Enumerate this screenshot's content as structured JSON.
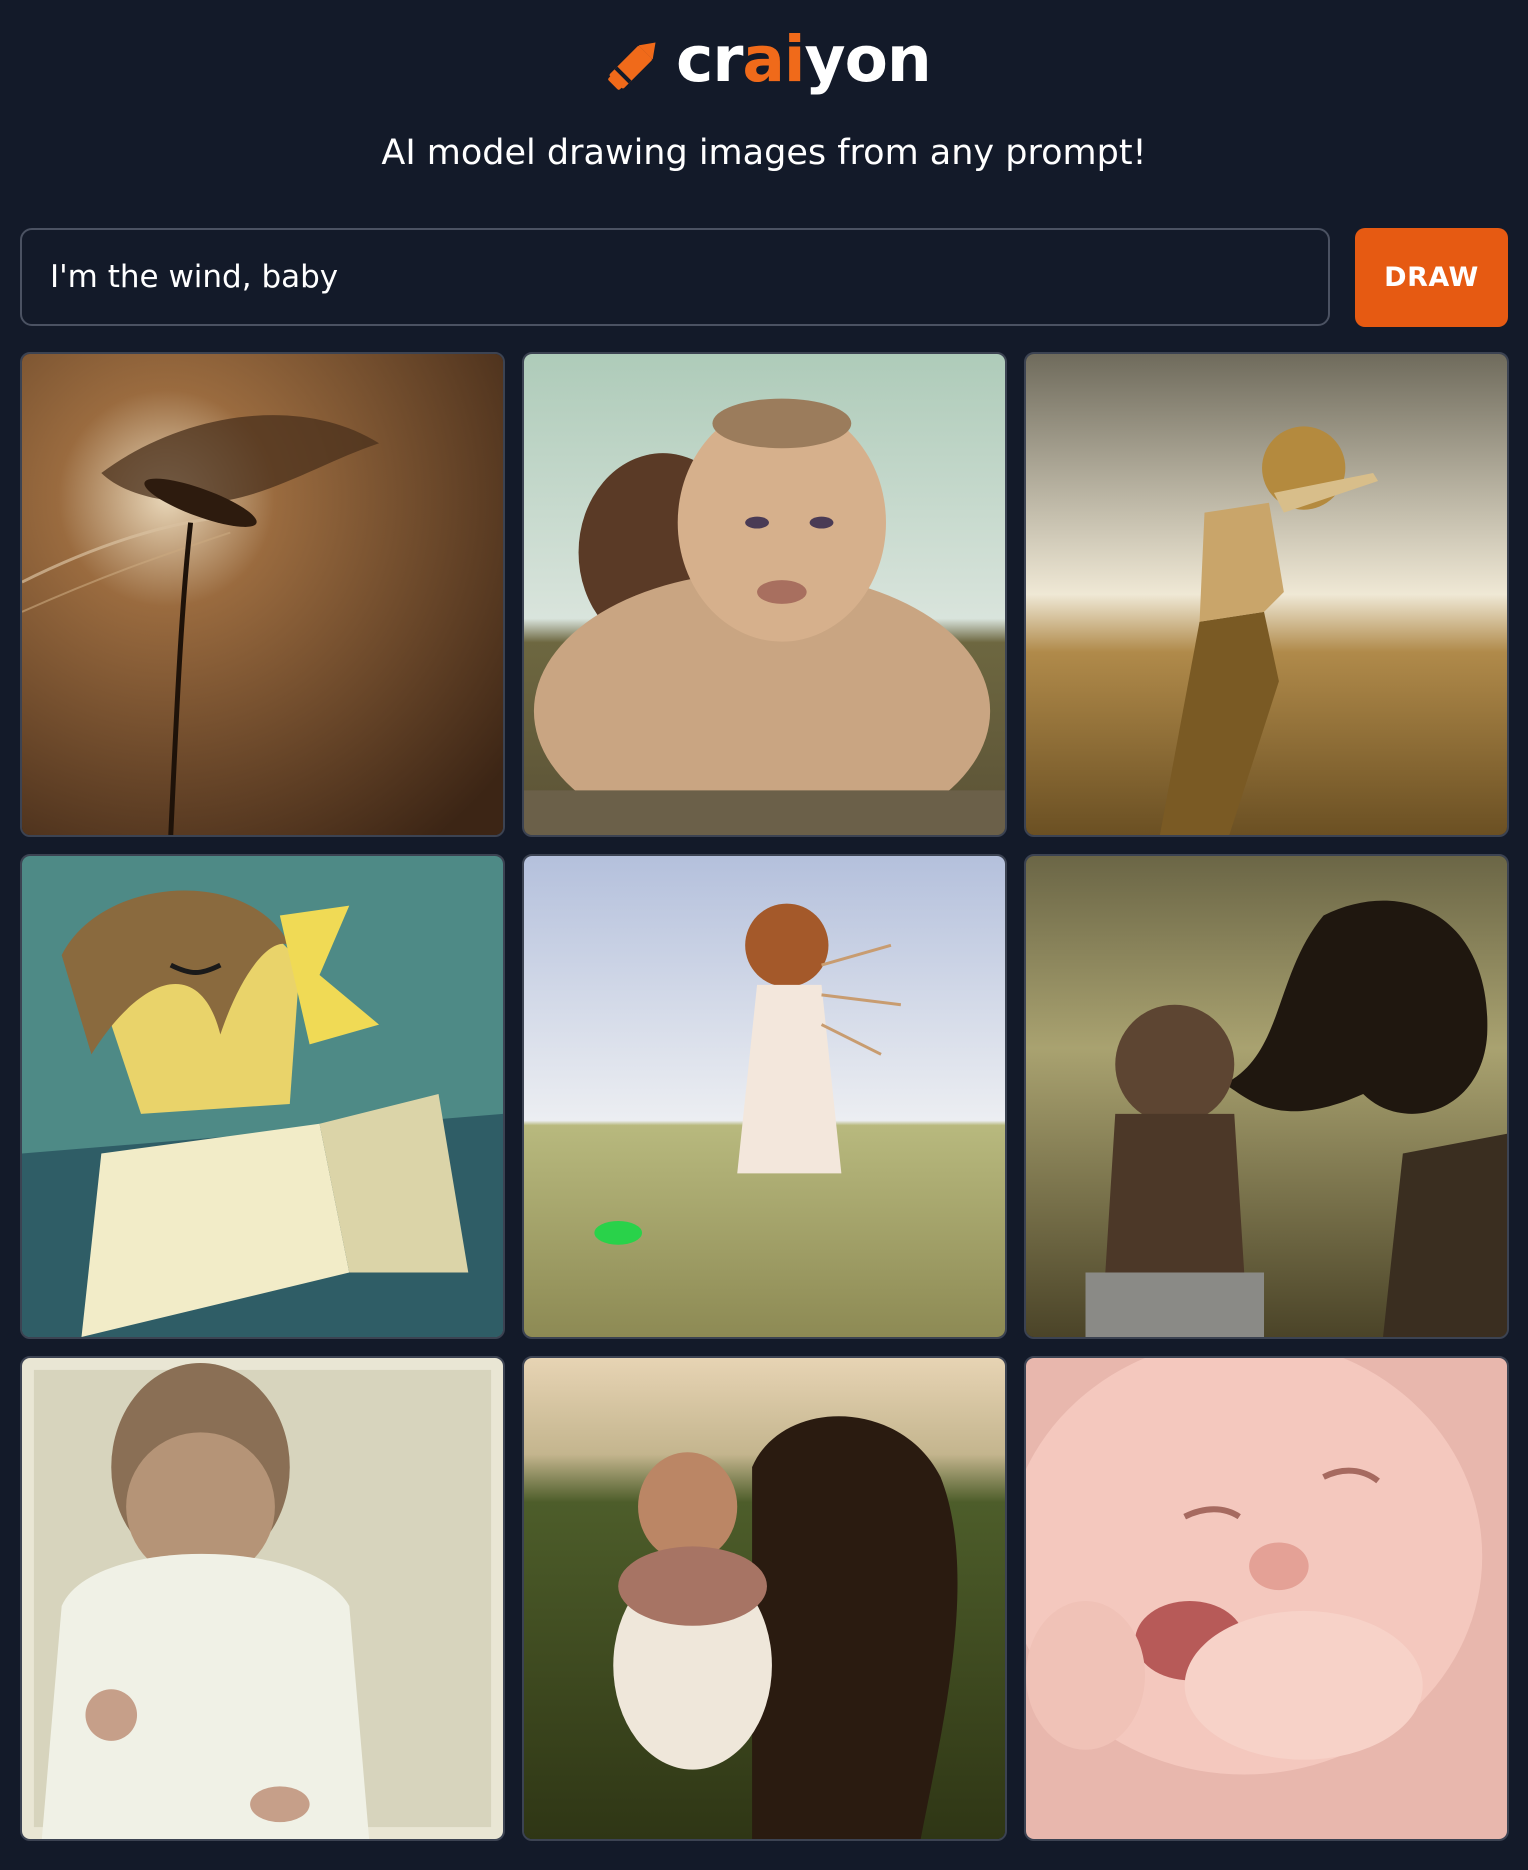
{
  "header": {
    "logo_prefix": "cr",
    "logo_accent": "ai",
    "logo_suffix": "yon",
    "tagline": "AI model drawing images from any prompt!"
  },
  "prompt": {
    "value": "I'm the wind, baby"
  },
  "draw_button": {
    "label": "DRAW"
  },
  "colors": {
    "background": "#131a29",
    "accent": "#f06a1a",
    "button": "#e65a12",
    "input_border": "#4b5262"
  },
  "icons": {
    "logo": "crayon-icon"
  },
  "results": {
    "count": 9,
    "columns": 3
  }
}
